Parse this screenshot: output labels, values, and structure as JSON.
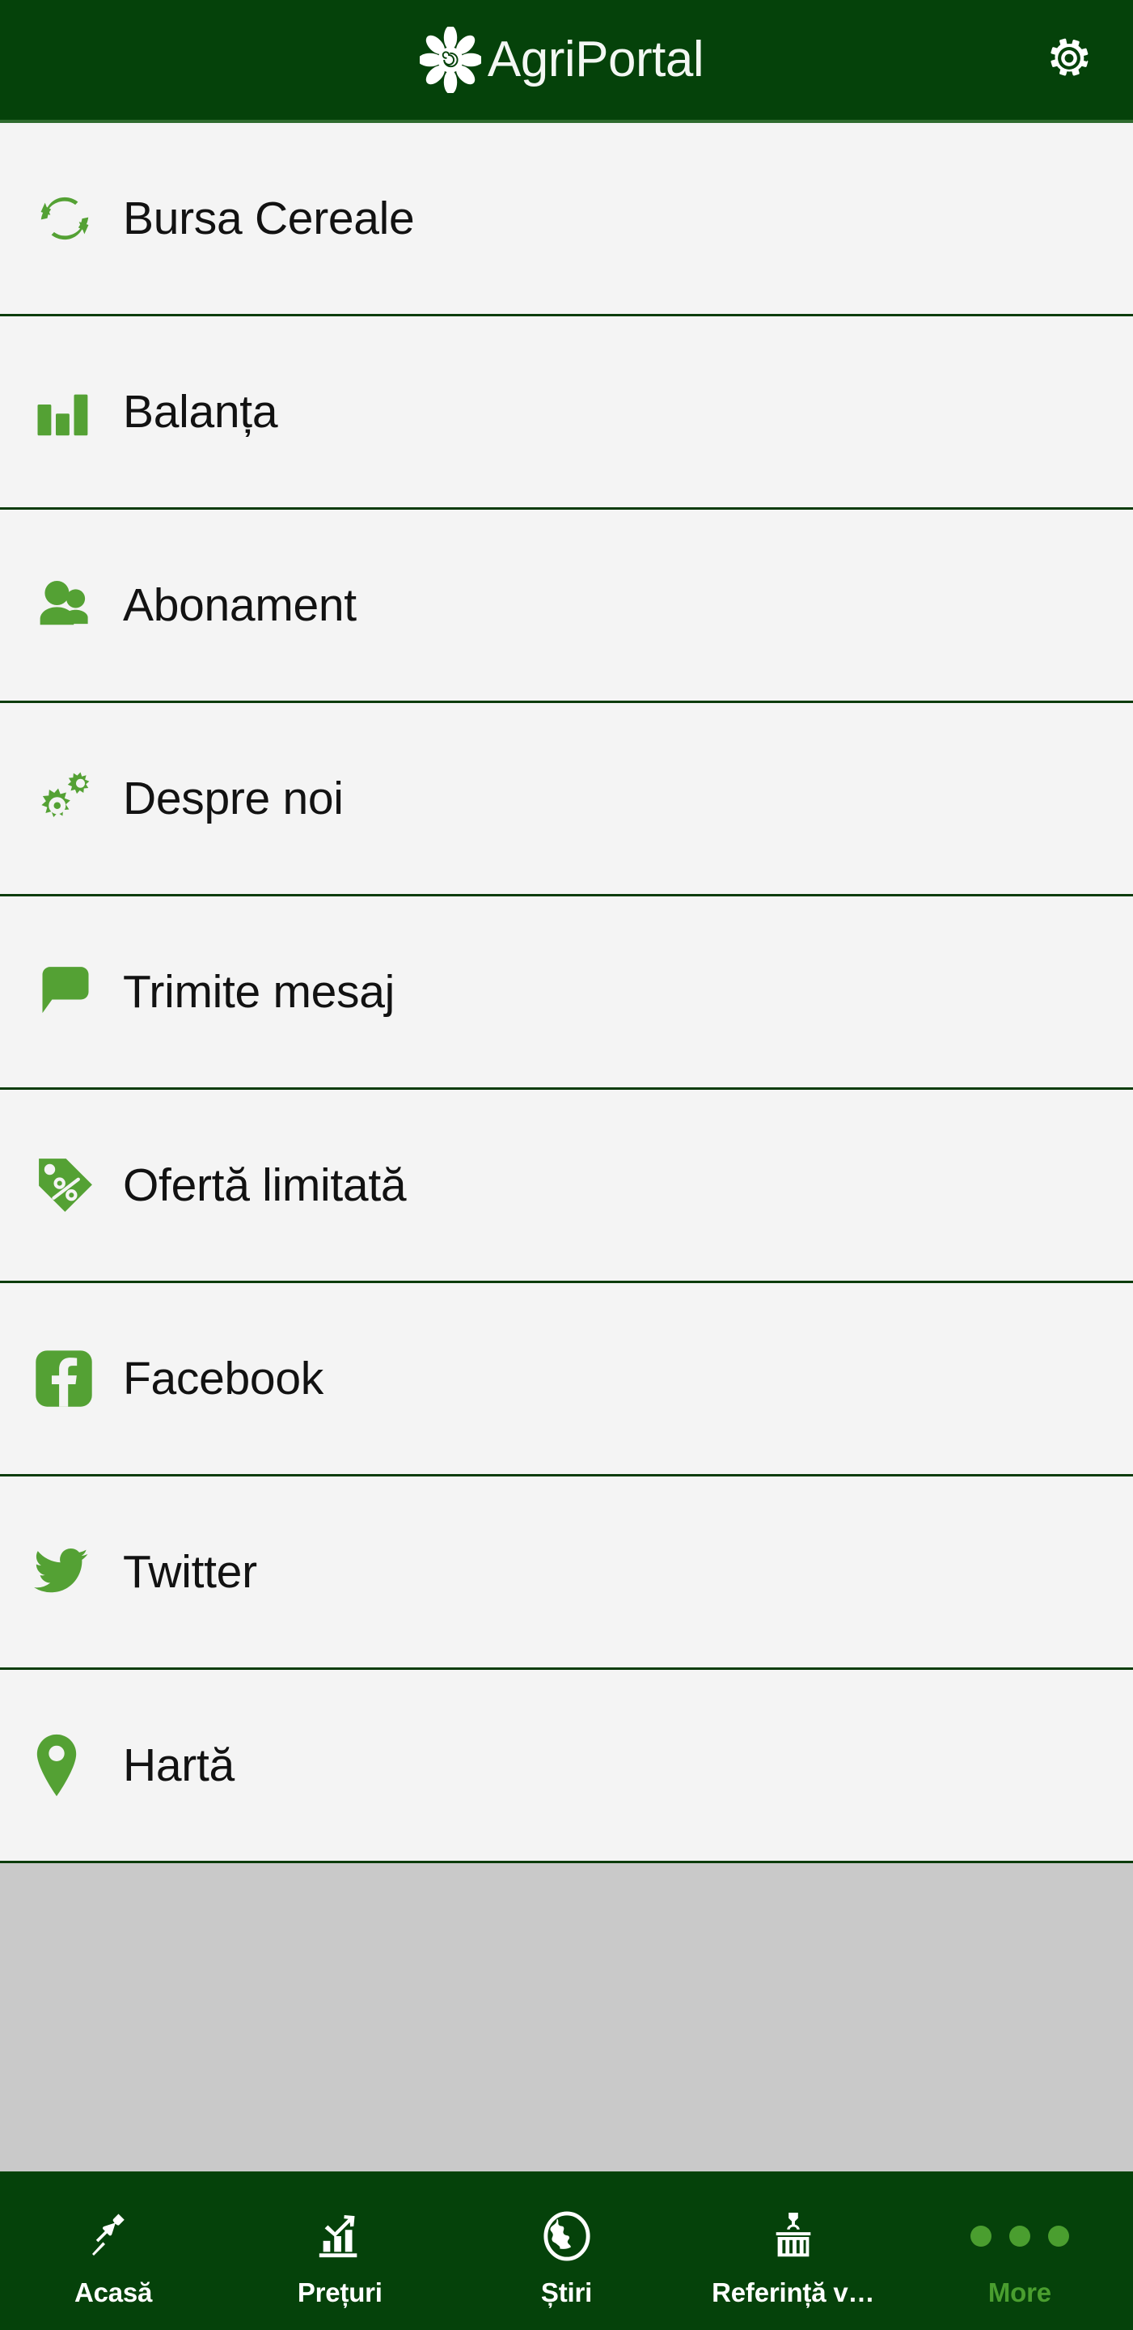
{
  "theme": {
    "header_green": "#05420a",
    "accent_green": "#54a134",
    "list_background": "#f4f4f4",
    "divider_green": "#0b3c0b",
    "filler_grey": "#c9c9c9",
    "active_tab_green": "#4a9e2f"
  },
  "header": {
    "brand_first": "Agri",
    "brand_second": "Portal",
    "logo_icon": "flower-logo-icon",
    "settings_icon": "gear-icon"
  },
  "menu": {
    "items": [
      {
        "label": "Bursa Cereale",
        "icon": "refresh-exchange-icon"
      },
      {
        "label": "Balanța",
        "icon": "bar-chart-icon"
      },
      {
        "label": "Abonament",
        "icon": "users-icon"
      },
      {
        "label": "Despre noi",
        "icon": "gears-icon"
      },
      {
        "label": "Trimite mesaj",
        "icon": "speech-bubble-icon"
      },
      {
        "label": "Ofertă limitată",
        "icon": "price-tag-percent-icon"
      },
      {
        "label": "Facebook",
        "icon": "facebook-icon"
      },
      {
        "label": "Twitter",
        "icon": "twitter-bird-icon"
      },
      {
        "label": "Hartă",
        "icon": "map-pin-icon"
      }
    ]
  },
  "tabbar": {
    "tabs": [
      {
        "label": "Acasă",
        "icon": "pushpin-icon",
        "active": false
      },
      {
        "label": "Prețuri",
        "icon": "chart-arrow-up-icon",
        "active": false
      },
      {
        "label": "Știri",
        "icon": "globe-icon",
        "active": false
      },
      {
        "label": "Referință v…",
        "icon": "shipping-container-icon",
        "active": false
      },
      {
        "label": "More",
        "icon": "ellipsis-dots-icon",
        "active": true
      }
    ]
  }
}
